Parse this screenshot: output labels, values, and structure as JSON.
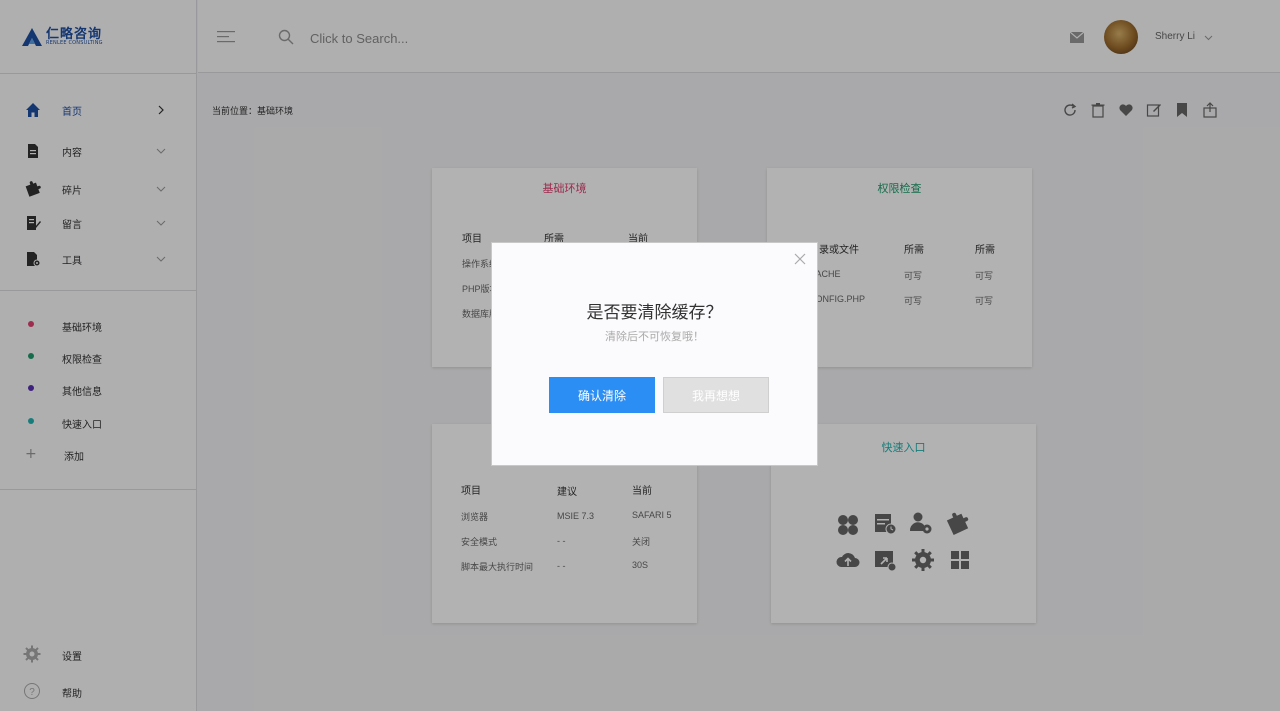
{
  "brand": {
    "name_cn": "仁略咨询",
    "name_en": "RENLEE CONSULTING",
    "color": "#1f4fa3"
  },
  "sidebar": {
    "nav": [
      {
        "label": "首页",
        "icon": "home-icon",
        "active": true
      },
      {
        "label": "内容",
        "icon": "document-icon"
      },
      {
        "label": "碎片",
        "icon": "puzzle-icon"
      },
      {
        "label": "留言",
        "icon": "message-edit-icon"
      },
      {
        "label": "工具",
        "icon": "tools-file-icon"
      }
    ],
    "sections": [
      {
        "label": "基础环境",
        "color": "#e23f72"
      },
      {
        "label": "权限检查",
        "color": "#1f9b6e"
      },
      {
        "label": "其他信息",
        "color": "#5a2fb5"
      },
      {
        "label": "快速入口",
        "color": "#21b3b0"
      }
    ],
    "add_label": "添加",
    "footer": {
      "settings": "设置",
      "help": "帮助"
    }
  },
  "header": {
    "search_placeholder": "Click to Search...",
    "user_name": "Sherry Li"
  },
  "breadcrumb": "当前位置：基础环境",
  "cards": {
    "env": {
      "title": "基础环境",
      "title_color": "#e23f72",
      "headers": [
        "项目",
        "所需",
        "当前"
      ],
      "rows": [
        "操作系统",
        "PHP版本",
        "数据库版本"
      ]
    },
    "perm": {
      "title": "权限检查",
      "title_color": "#1f9b6e",
      "headers": [
        "目录或文件",
        "所需",
        "所需"
      ],
      "rows": [
        [
          "CACHE",
          "可写",
          "可写"
        ],
        [
          "CONFIG.PHP",
          "可写",
          "可写"
        ]
      ]
    },
    "other": {
      "headers": [
        "项目",
        "建议",
        "当前"
      ],
      "rows": [
        [
          "浏览器",
          "MSIE 7.3",
          "SAFARI 5"
        ],
        [
          "安全模式",
          "- -",
          "关闭"
        ],
        [
          "脚本最大执行时间",
          "- -",
          "30S"
        ]
      ]
    },
    "quick": {
      "title": "快速入口",
      "title_color": "#21b3b0",
      "icons": [
        "clover-icon",
        "calendar-clock-icon",
        "user-settings-icon",
        "puzzle-icon",
        "cloud-upload-icon",
        "image-share-icon",
        "gear-icon",
        "grid-icon"
      ]
    }
  },
  "modal": {
    "title": "是否要清除缓存？",
    "subtitle": "清除后不可恢复哦！",
    "confirm_label": "确认清除",
    "cancel_label": "我再想想",
    "confirm_color": "#2b8ef4"
  }
}
